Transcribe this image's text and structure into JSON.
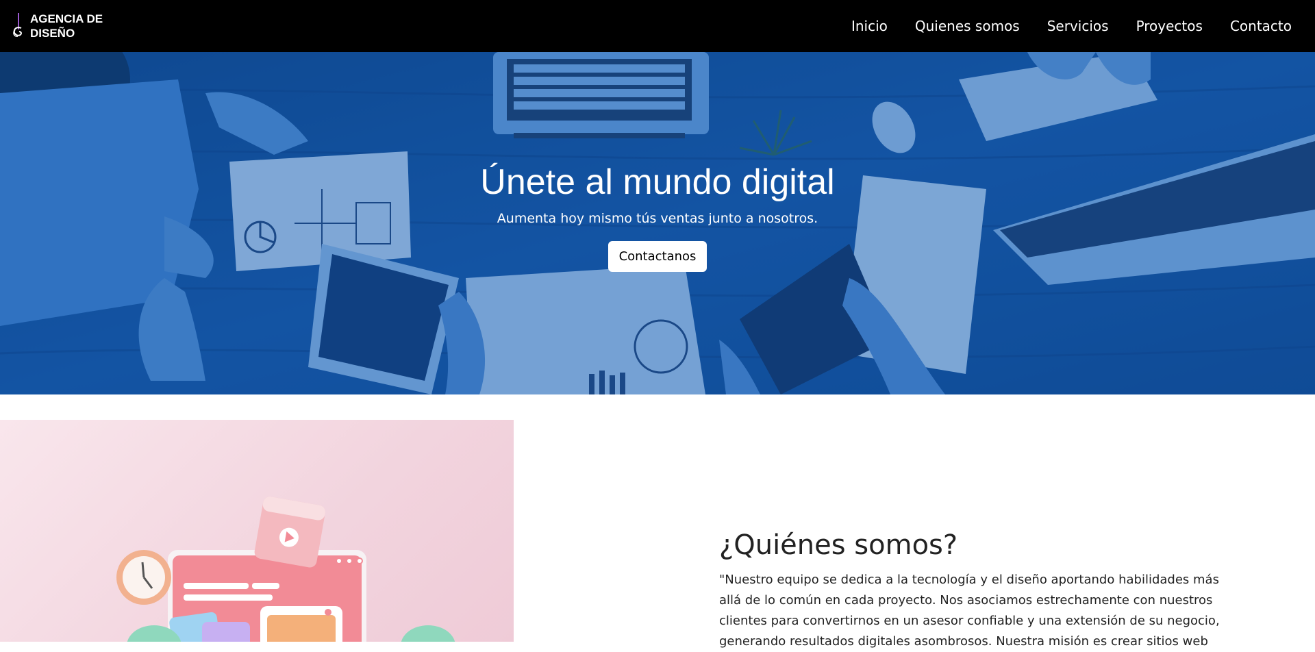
{
  "navbar": {
    "brand": "AGENCIA DE DISEÑO",
    "links": [
      "Inicio",
      "Quienes somos",
      "Servicios",
      "Proyectos",
      "Contacto"
    ]
  },
  "hero": {
    "title": "Únete al mundo digital",
    "subtitle": "Aumenta hoy mismo tús ventas junto a nosotros.",
    "cta": "Contactanos"
  },
  "about": {
    "title": "¿Quiénes somos?",
    "body": "\"Nuestro equipo se dedica a la tecnología y el diseño aportando habilidades más allá de lo común en cada proyecto. Nos asociamos estrechamente con nuestros clientes para convertirnos en un asesor confiable y una extensión de su negocio, generando resultados digitales asombrosos. Nuestra misión es crear sitios web"
  },
  "colors": {
    "navbar_bg": "#000000",
    "hero_tint": "#1d5fb3",
    "about_bg": "#f2d4de"
  }
}
